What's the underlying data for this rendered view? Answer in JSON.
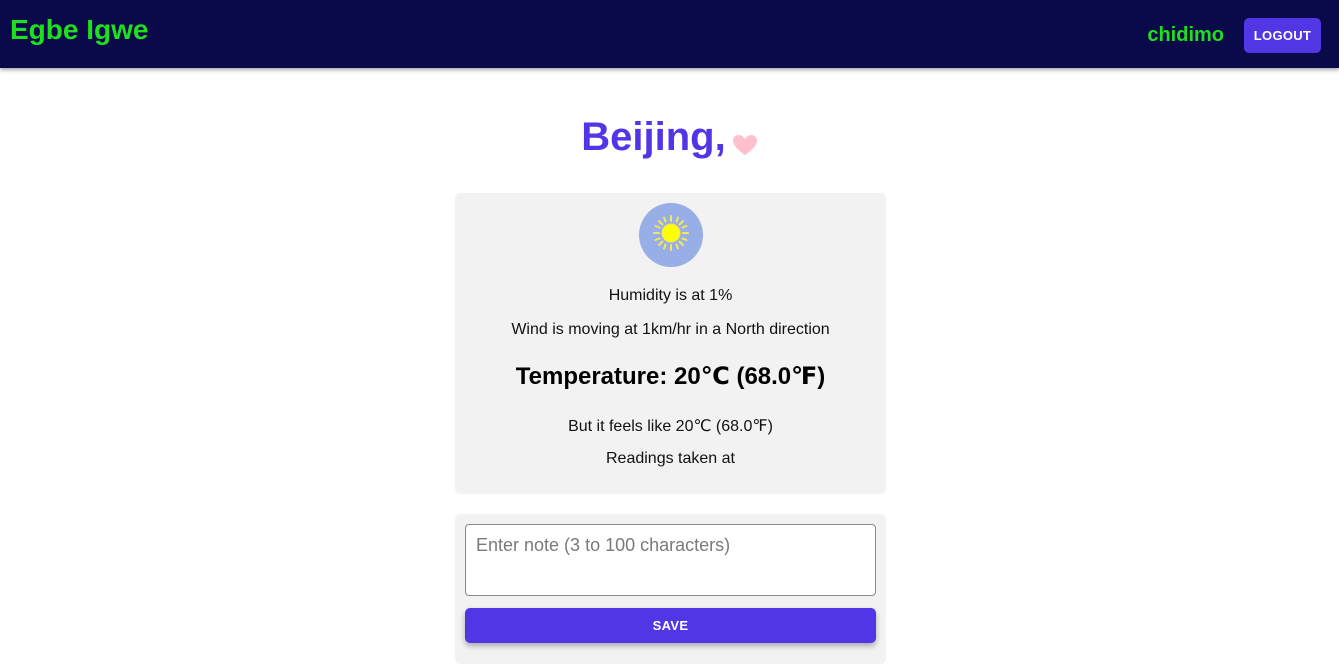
{
  "header": {
    "brand": "Egbe Igwe",
    "username": "chidimo",
    "logout_label": "LOGOUT"
  },
  "city": {
    "title": "Beijing,",
    "favorite_icon": "heart-icon"
  },
  "weather": {
    "icon": "sun-icon",
    "humidity": "Humidity is at 1%",
    "wind": "Wind is moving at 1km/hr in a North direction",
    "temperature": "Temperature: 20℃ (68.0℉)",
    "feels_like": "But it feels like 20℃ (68.0℉)",
    "readings": "Readings taken at"
  },
  "note": {
    "placeholder": "Enter note (3 to 100 characters)",
    "value": "",
    "save_label": "SAVE"
  },
  "colors": {
    "header_bg": "#0a0a4a",
    "brand_green": "#1ee01e",
    "accent_purple": "#5136e6",
    "card_bg": "#f2f2f2",
    "heart_pink": "#ffc0cb",
    "sun_bg": "#98aee6",
    "sun_yellow": "#ffff00"
  }
}
